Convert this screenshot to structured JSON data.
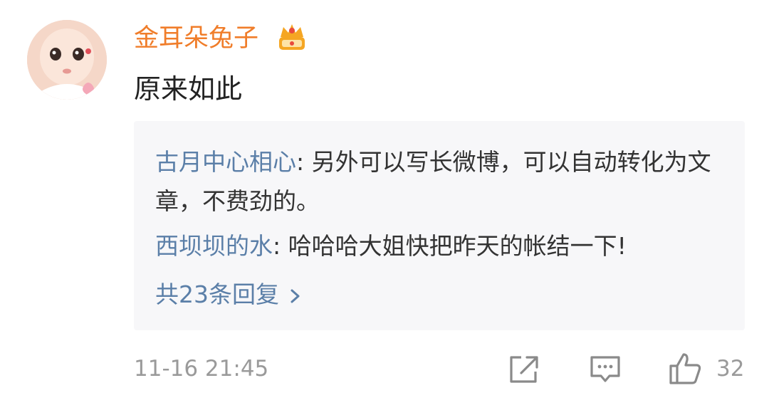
{
  "comment": {
    "username": "金耳朵兔子",
    "text": "原来如此",
    "timestamp": "11-16 21:45",
    "like_count": "32"
  },
  "replies": [
    {
      "name": "古月中心相心",
      "separator": ": ",
      "text": "另外可以写长微博，可以自动转化为文章，不费劲的。"
    },
    {
      "name": "西坝坝的水",
      "separator": ": ",
      "text": "哈哈哈大姐快把昨天的帐结一下!"
    }
  ],
  "replies_more_label": "共23条回复",
  "colors": {
    "username": "#f07d2a",
    "link": "#5b7fa8",
    "muted": "#9a9a9a",
    "reply_bg": "#f7f7f9"
  },
  "icons": {
    "badge": "crown-icon",
    "share": "share-icon",
    "reply": "comment-icon",
    "like": "thumbs-up-icon",
    "more": "chevron-right-icon"
  }
}
